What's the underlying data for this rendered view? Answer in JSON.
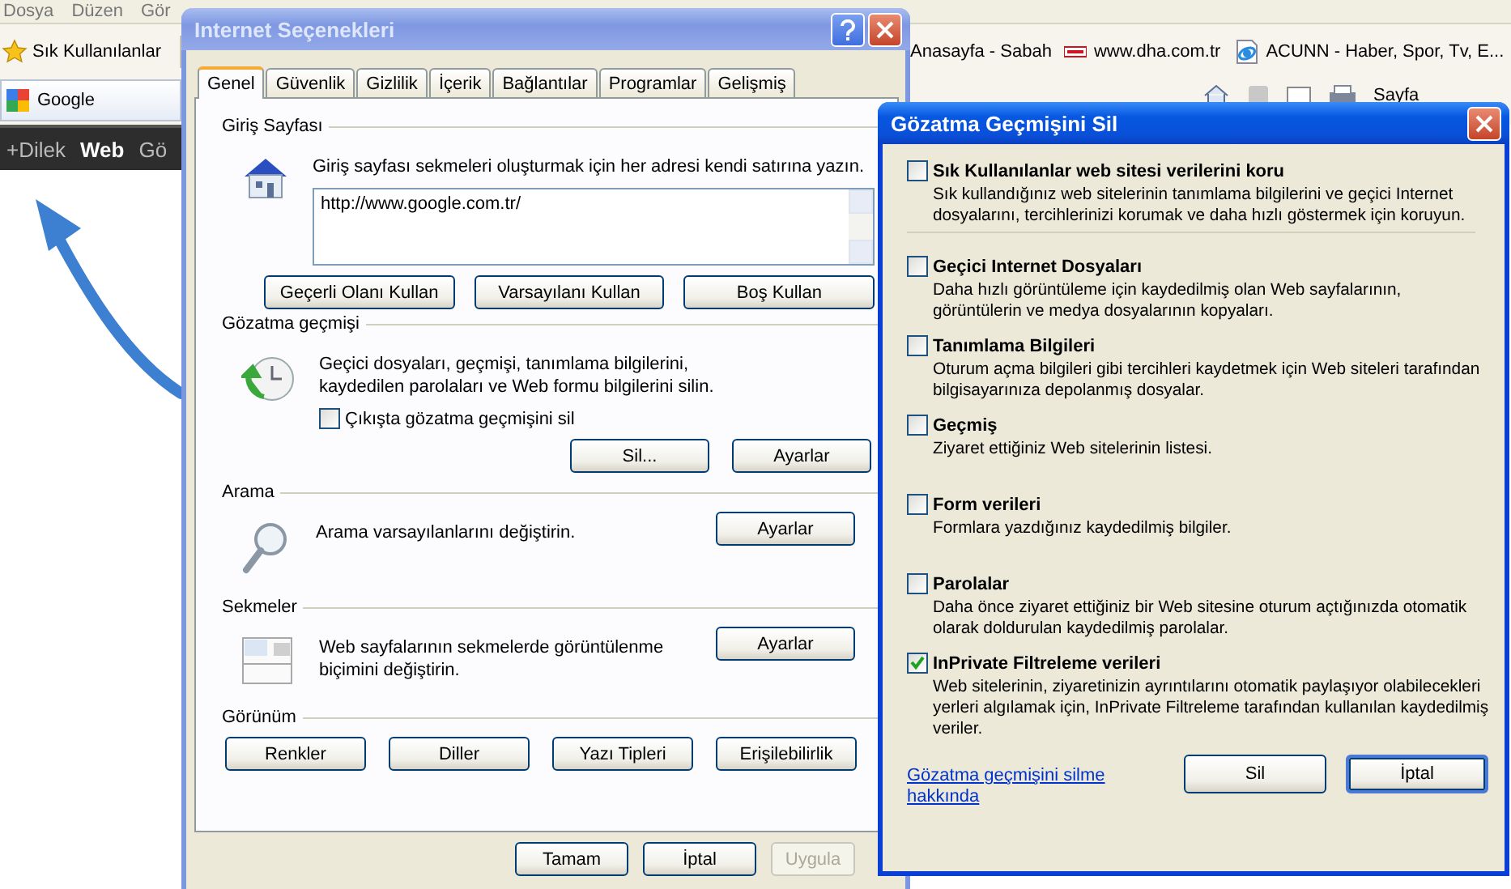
{
  "browser": {
    "menu": [
      {
        "label": "Dosya"
      },
      {
        "label": "Düzen"
      },
      {
        "label": "Gör"
      }
    ],
    "favorites_button": "Sık Kullanılanlar",
    "links": [
      {
        "label": "Anasayfa - Sabah",
        "kind": "plain"
      },
      {
        "label": "www.dha.com.tr",
        "kind": "dha"
      },
      {
        "label": "ACUNN - Haber, Spor, Tv, E...",
        "kind": "page"
      }
    ],
    "tab": "Google",
    "page_menu": "Sayfa",
    "google_bar": [
      {
        "label": "+Dilek",
        "selected": false
      },
      {
        "label": "Web",
        "selected": true
      },
      {
        "label": "Gö",
        "selected": false
      }
    ]
  },
  "internet_options": {
    "title": "Internet Seçenekleri",
    "active": false,
    "tabs": [
      {
        "label": "Genel",
        "selected": true
      },
      {
        "label": "Güvenlik",
        "selected": false
      },
      {
        "label": "Gizlilik",
        "selected": false
      },
      {
        "label": "İçerik",
        "selected": false
      },
      {
        "label": "Bağlantılar",
        "selected": false
      },
      {
        "label": "Programlar",
        "selected": false
      },
      {
        "label": "Gelişmiş",
        "selected": false
      }
    ],
    "home": {
      "label": "Giriş Sayfası",
      "description": "Giriş sayfası sekmeleri oluşturmak için her adresi kendi satırına yazın.",
      "value": "http://www.google.com.tr/",
      "buttons": [
        "Geçerli Olanı Kullan",
        "Varsayılanı Kullan",
        "Boş Kullan"
      ]
    },
    "history": {
      "label": "Gözatma geçmişi",
      "description": "Geçici dosyaları, geçmişi, tanımlama bilgilerini, kaydedilen parolaları ve Web formu bilgilerini silin.",
      "checkbox": {
        "label": "Çıkışta gözatma geçmişini sil",
        "checked": false
      },
      "buttons": [
        "Sil...",
        "Ayarlar"
      ]
    },
    "search": {
      "label": "Arama",
      "description": "Arama varsayılanlarını değiştirin.",
      "button": "Ayarlar"
    },
    "tabs_section": {
      "label": "Sekmeler",
      "description": "Web sayfalarının sekmelerde görüntülenme biçimini değiştirin.",
      "button": "Ayarlar"
    },
    "appearance": {
      "label": "Görünüm",
      "buttons": [
        "Renkler",
        "Diller",
        "Yazı Tipleri",
        "Erişilebilirlik"
      ]
    },
    "footer_buttons": [
      {
        "label": "Tamam",
        "disabled": false
      },
      {
        "label": "İptal",
        "disabled": false
      },
      {
        "label": "Uygula",
        "disabled": true
      }
    ]
  },
  "delete_history": {
    "title": "Gözatma Geçmişini Sil",
    "active": true,
    "preserve": {
      "title": "Sık Kullanılanlar web sitesi verilerini koru",
      "description": "Sık kullandığınız web sitelerinin tanımlama bilgilerini ve geçici Internet dosyalarını, tercihlerinizi korumak ve daha hızlı göstermek için koruyun.",
      "checked": false
    },
    "options": [
      {
        "title": "Geçici Internet Dosyaları",
        "description": "Daha hızlı görüntüleme için kaydedilmiş olan Web sayfalarının, görüntülerin ve medya dosyalarının kopyaları.",
        "checked": false
      },
      {
        "title": "Tanımlama Bilgileri",
        "description": "Oturum açma bilgileri gibi tercihleri kaydetmek için Web siteleri tarafından bilgisayarınıza depolanmış dosyalar.",
        "checked": false
      },
      {
        "title": "Geçmiş",
        "description": "Ziyaret ettiğiniz Web sitelerinin listesi.",
        "checked": false
      },
      {
        "title": "Form verileri",
        "description": "Formlara yazdığınız kaydedilmiş bilgiler.",
        "checked": false
      },
      {
        "title": "Parolalar",
        "description": "Daha önce ziyaret ettiğiniz bir Web sitesine oturum açtığınızda otomatik olarak doldurulan kaydedilmiş parolalar.",
        "checked": false
      },
      {
        "title": "InPrivate Filtreleme verileri",
        "description": "Web sitelerinin, ziyaretinizin ayrıntılarını otomatik paylaşıyor olabilecekleri yerleri algılamak için, InPrivate Filtreleme tarafından kullanılan kaydedilmiş veriler.",
        "checked": true
      }
    ],
    "help_link": "Gözatma geçmişini silme hakkında",
    "buttons": [
      {
        "label": "Sil",
        "default": false
      },
      {
        "label": "İptal",
        "default": true
      }
    ]
  }
}
